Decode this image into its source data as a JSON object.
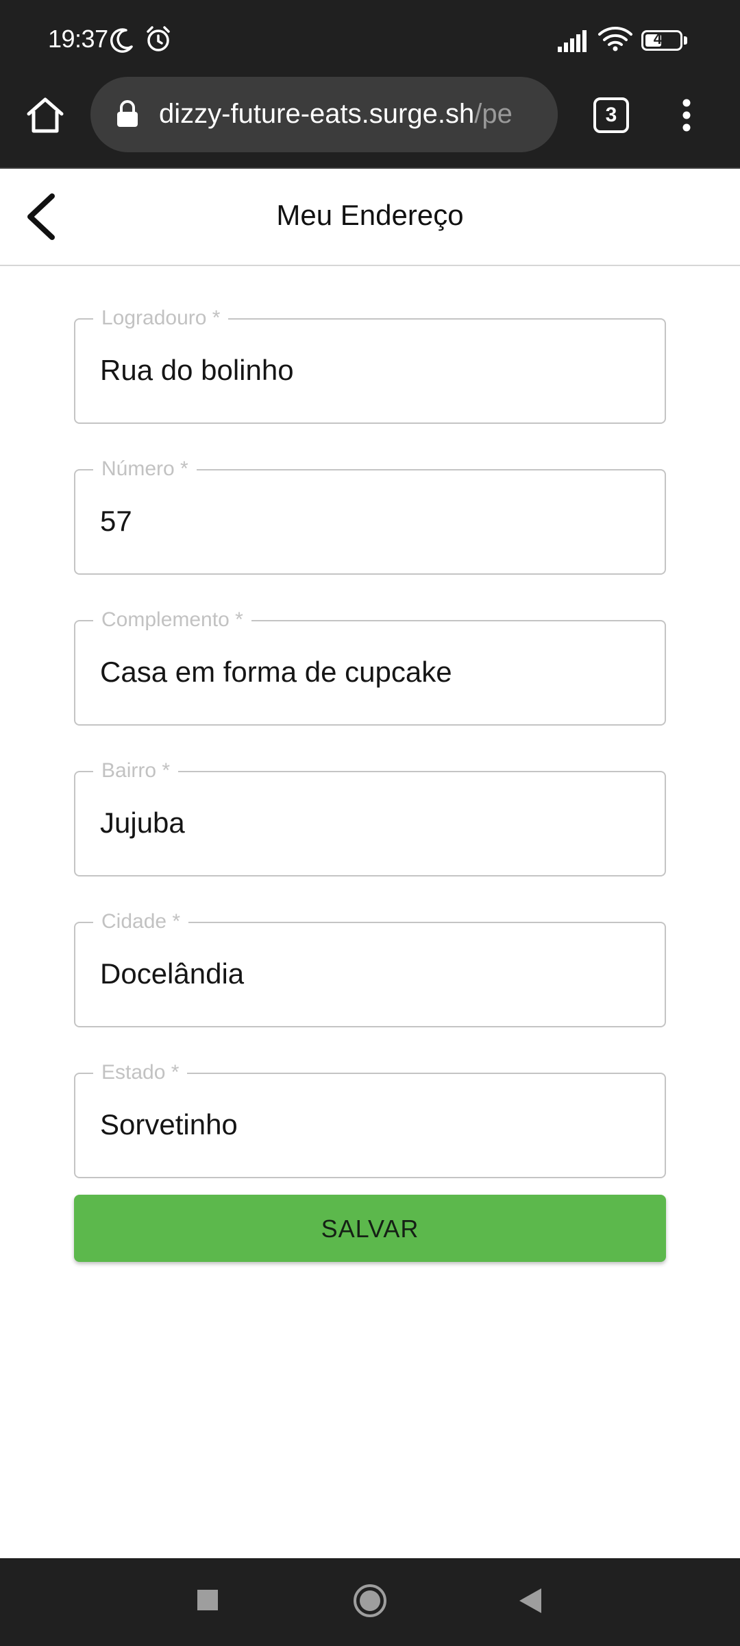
{
  "status_bar": {
    "time": "19:37",
    "battery_level": "48",
    "battery_fraction": 0.48,
    "icons": [
      "moon-icon",
      "alarm-icon",
      "signal-icon",
      "wifi-icon",
      "battery-icon"
    ]
  },
  "browser": {
    "url_host": "dizzy-future-eats.surge.sh",
    "url_path": "/pe",
    "tab_count": "3"
  },
  "header": {
    "title": "Meu Endereço"
  },
  "form": {
    "fields": [
      {
        "label": "Logradouro *",
        "value": "Rua do bolinho"
      },
      {
        "label": "Número *",
        "value": "57"
      },
      {
        "label": "Complemento *",
        "value": "Casa em forma de cupcake"
      },
      {
        "label": "Bairro *",
        "value": "Jujuba"
      },
      {
        "label": "Cidade *",
        "value": "Docelândia"
      },
      {
        "label": "Estado *",
        "value": "Sorvetinho"
      }
    ],
    "submit_label": "SALVAR"
  },
  "colors": {
    "system_bar": "#202020",
    "accent_green": "#5cb84c",
    "label_gray": "#c2c2c2",
    "border_gray": "#c4c4c4"
  }
}
